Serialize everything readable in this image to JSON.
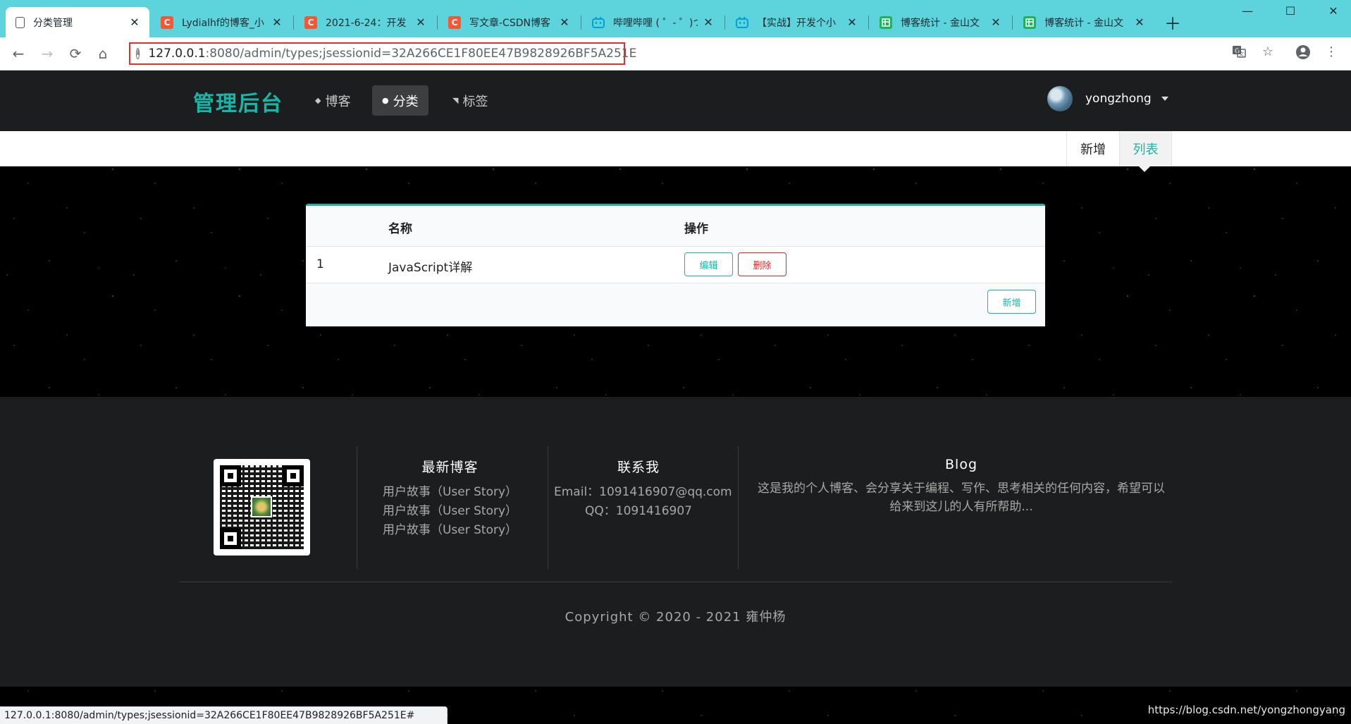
{
  "browser": {
    "tabs": [
      {
        "title": "分类管理",
        "icon": "page-icon"
      },
      {
        "title": "Lydialhf的博客_小",
        "icon": "csdn-icon"
      },
      {
        "title": "2021-6-24：开发",
        "icon": "csdn-icon"
      },
      {
        "title": "写文章-CSDN博客",
        "icon": "csdn-icon"
      },
      {
        "title": "哔哩哔哩 ( ゜- ゜)つ",
        "icon": "bilibili-icon"
      },
      {
        "title": "【实战】开发个小",
        "icon": "bilibili-icon"
      },
      {
        "title": "博客统计 - 金山文",
        "icon": "sheet-icon"
      },
      {
        "title": "博客统计 - 金山文",
        "icon": "sheet-icon"
      }
    ],
    "url_host": "127.0.0.1",
    "url_path": ":8080/admin/types;jsessionid=32A266CE1F80EE47B9828926BF5A251E",
    "status_url": "127.0.0.1:8080/admin/types;jsessionid=32A266CE1F80EE47B9828926BF5A251E#"
  },
  "header": {
    "brand": "管理后台",
    "menu": [
      {
        "label": "博客",
        "icon": "home-icon"
      },
      {
        "label": "分类",
        "icon": "idea-icon"
      },
      {
        "label": "标签",
        "icon": "tags-icon"
      }
    ],
    "username": "yongzhong"
  },
  "subnav": {
    "new_label": "新增",
    "list_label": "列表"
  },
  "table": {
    "columns": [
      "",
      "名称",
      "操作"
    ],
    "rows": [
      {
        "index": "1",
        "name": "JavaScript详解",
        "edit": "编辑",
        "delete": "删除"
      }
    ],
    "add_label": "新增"
  },
  "footer": {
    "latest_title": "最新博客",
    "latest_items": [
      "用户故事（User Story）",
      "用户故事（User Story）",
      "用户故事（User Story）"
    ],
    "contact_title": "联系我",
    "email": "Email：1091416907@qq.com",
    "qq": "QQ：1091416907",
    "blog_title": "Blog",
    "blog_text": "这是我的个人博客、会分享关于编程、写作、思考相关的任何内容，希望可以给来到这儿的人有所帮助...",
    "copyright": "Copyright © 2020 - 2021 雍仲杨"
  },
  "watermark": "https://blog.csdn.net/yongzhongyang",
  "colors": {
    "accent": "#16b6a8",
    "danger": "#db2828",
    "tabbar": "#5dd3dc",
    "header_bg": "#1c1d1e"
  }
}
